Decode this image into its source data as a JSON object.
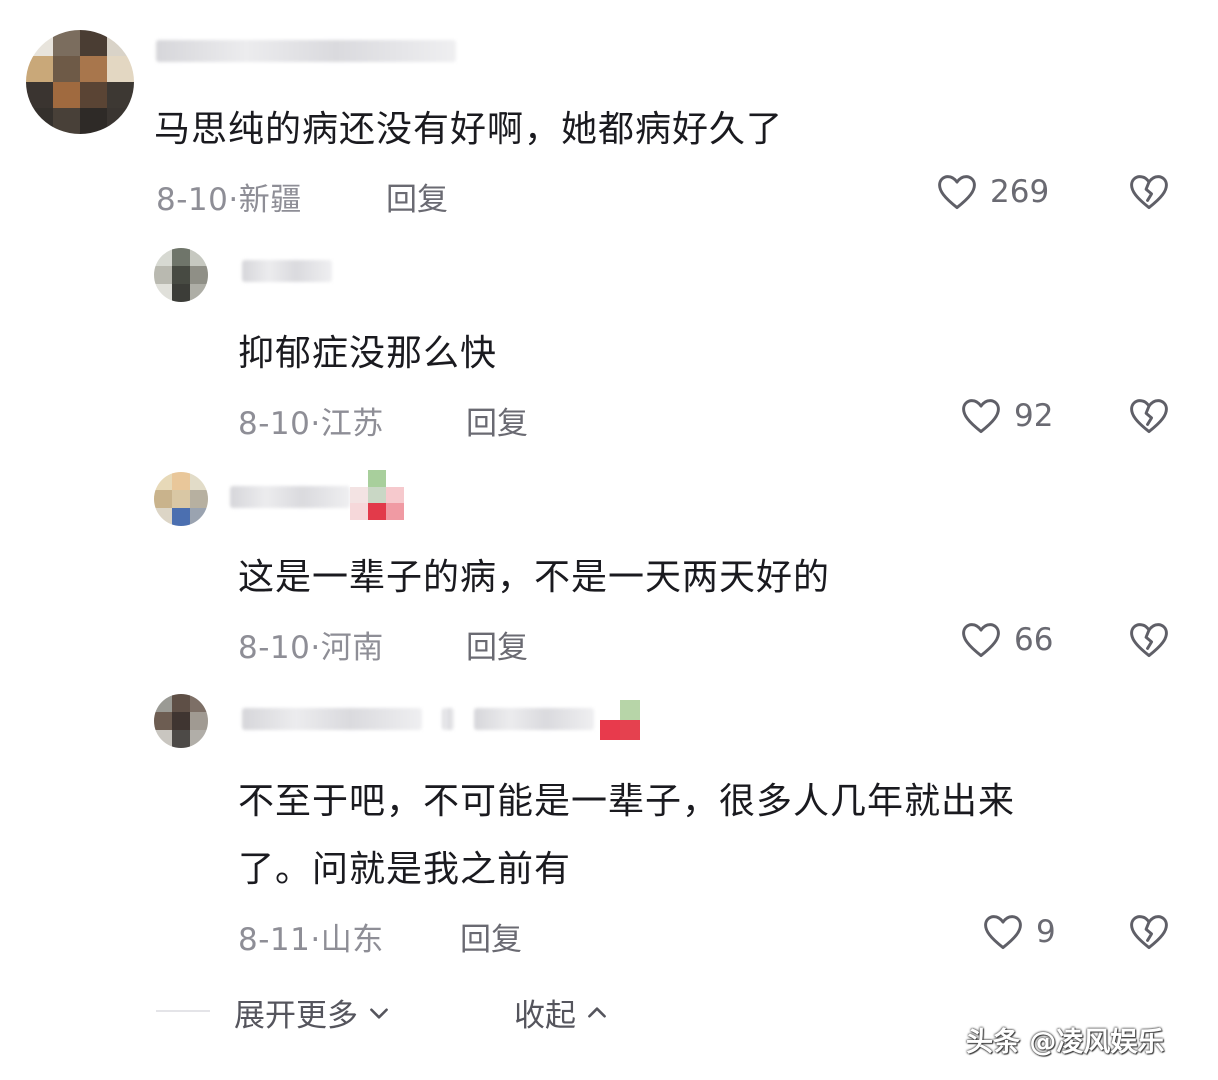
{
  "comments": [
    {
      "text": "马思纯的病还没有好啊，她都病好久了",
      "date": "8-10",
      "region": "新疆",
      "reply_label": "回复",
      "likes": "269"
    },
    {
      "text": "抑郁症没那么快",
      "date": "8-10",
      "region": "江苏",
      "reply_label": "回复",
      "likes": "92"
    },
    {
      "text": "这是一辈子的病，不是一天两天好的",
      "date": "8-10",
      "region": "河南",
      "reply_label": "回复",
      "likes": "66"
    },
    {
      "text_line1": "不至于吧，不可能是一辈子，很多人几年就出来",
      "text_line2": "了。问就是我之前有",
      "date": "8-11",
      "region": "山东",
      "reply_label": "回复",
      "likes": "9"
    }
  ],
  "footer": {
    "expand_label": "展开更多",
    "collapse_label": "收起"
  },
  "watermark": "头条 @凌风娱乐",
  "separator": "·",
  "icons": {
    "like": "heart-outline-icon",
    "dislike": "broken-heart-icon",
    "expand": "chevron-down-icon",
    "collapse": "chevron-up-icon"
  }
}
